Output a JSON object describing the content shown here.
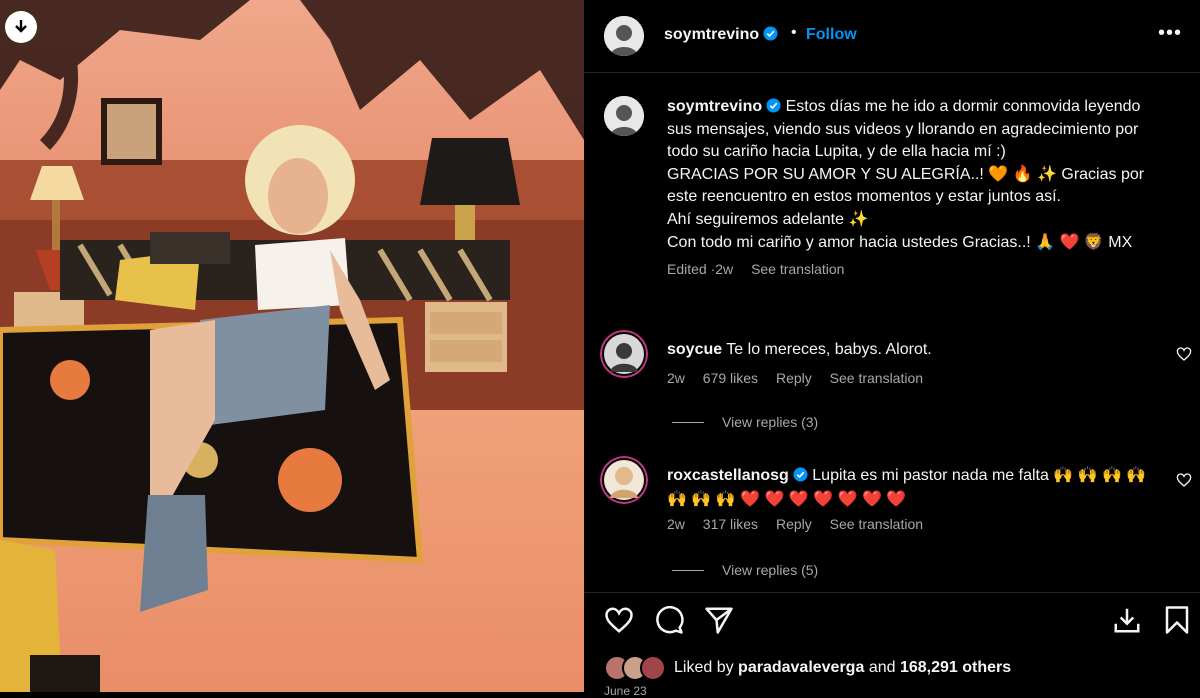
{
  "post": {
    "username": "soymtrevino",
    "follow_label": "Follow",
    "separator": "•",
    "more_label": "•••",
    "caption_lines": [
      "Estos días me he ido a dormir conmovida leyendo sus mensajes, viendo sus videos y llorando en agradecimiento por todo su cariño hacia Lupita, y de ella hacia mí :)",
      "GRACIAS POR SU AMOR Y SU ALEGRÍA..! 🧡 🔥 ✨  Gracias por este reencuentro en estos momentos y estar juntos así.",
      "Ahí seguiremos adelante ✨",
      "Con todo mi cariño y amor hacia ustedes Gracias..! 🙏 ❤️ 🦁 MX"
    ],
    "caption_meta": {
      "edited": "Edited",
      "dot": "·",
      "time": "2w",
      "translation": "See translation"
    }
  },
  "comments": [
    {
      "username": "soycue",
      "text": "Te lo mereces, babys. Alorot.",
      "time": "2w",
      "likes": "679 likes",
      "reply": "Reply",
      "translation": "See translation",
      "view_replies": "View replies (3)"
    },
    {
      "username": "roxcastellanosg",
      "text": "Lupita es mi pastor nada me falta 🙌 🙌 🙌 🙌 🙌 🙌 🙌 ❤️ ❤️ ❤️ ❤️ ❤️ ❤️ ❤️",
      "time": "2w",
      "likes": "317 likes",
      "reply": "Reply",
      "translation": "See translation",
      "view_replies": "View replies (5)"
    }
  ],
  "likes": {
    "prefix": "Liked by",
    "user": "paradavaleverga",
    "and": "and",
    "count": "168,291 others"
  },
  "date": "June 23",
  "colors": {
    "accent": "#0095f6",
    "secondary_text": "#a8a8a8",
    "border": "#262626"
  },
  "icons": [
    "download-icon",
    "verified-icon",
    "more-icon",
    "heart-icon",
    "comment-icon",
    "share-icon",
    "save-icon",
    "bookmark-icon"
  ]
}
